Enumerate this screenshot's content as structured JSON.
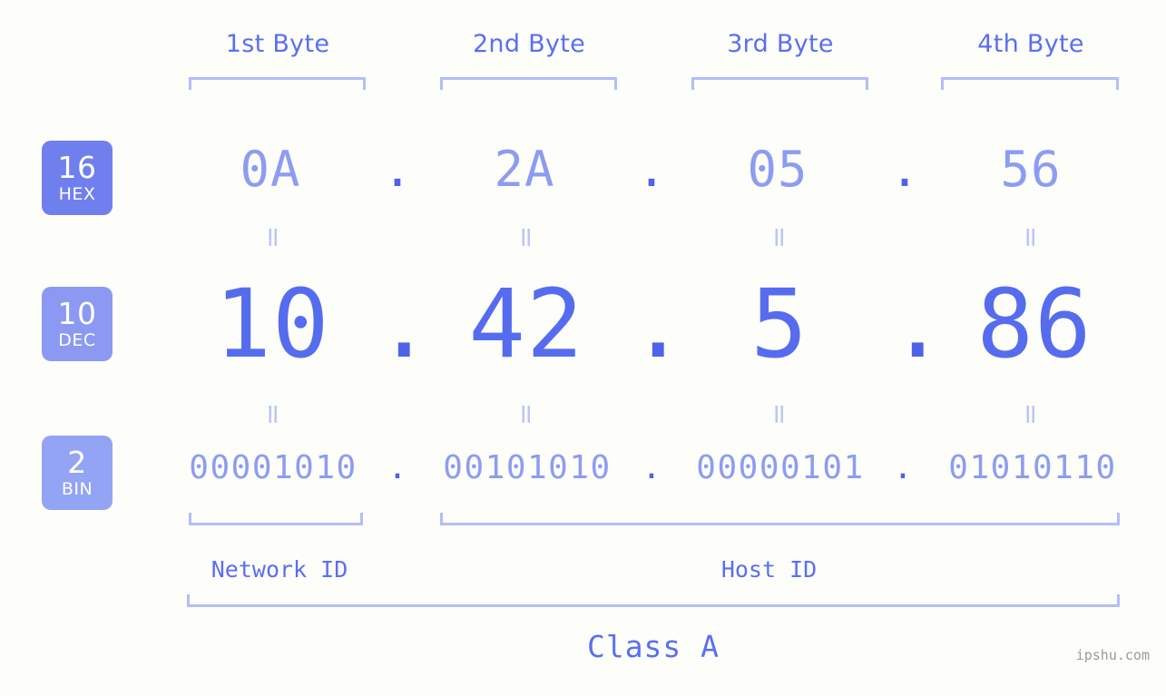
{
  "background_color": "#fdfdfa",
  "accent_color": "#5a6ff0",
  "bracket_color": "#b3bdf7",
  "byte_headers": [
    {
      "label": "1st Byte"
    },
    {
      "label": "2nd Byte"
    },
    {
      "label": "3rd Byte"
    },
    {
      "label": "4th Byte"
    }
  ],
  "bases": [
    {
      "number": "16",
      "name": "HEX",
      "color": "#6f80ee"
    },
    {
      "number": "10",
      "name": "DEC",
      "color": "#8b99f2"
    },
    {
      "number": "2",
      "name": "BIN",
      "color": "#93a4f5"
    }
  ],
  "rows": {
    "hex": {
      "values": [
        "0A",
        "2A",
        "05",
        "56"
      ],
      "separator": "."
    },
    "dec": {
      "values": [
        "10",
        "42",
        "5",
        "86"
      ],
      "separator": "."
    },
    "bin": {
      "values": [
        "00001010",
        "00101010",
        "00000101",
        "01010110"
      ],
      "separator": "."
    }
  },
  "equals_mark": "=",
  "segments": {
    "network_id": "Network ID",
    "host_id": "Host ID"
  },
  "class_label": "Class A",
  "watermark": "ipshu.com"
}
